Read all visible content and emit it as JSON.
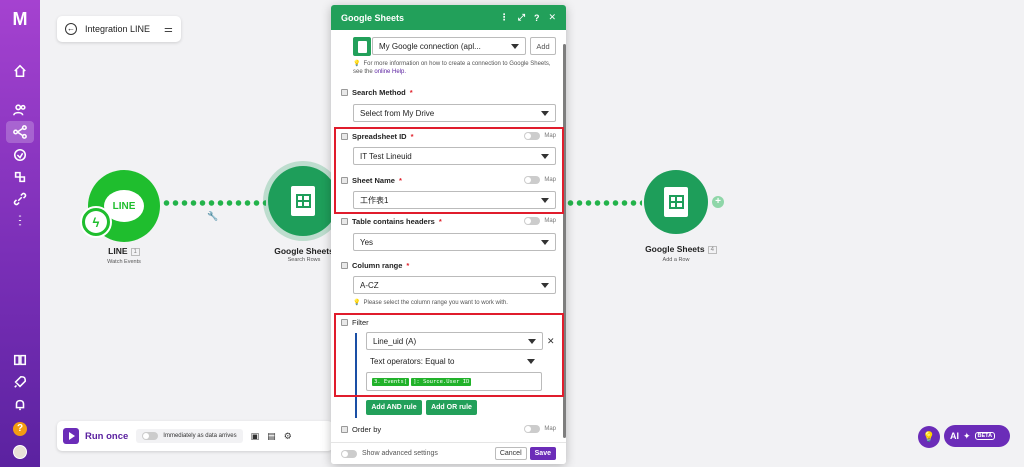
{
  "scenario": {
    "title": "Integration LINE"
  },
  "modules": [
    {
      "name": "LINE",
      "number": "1",
      "sub": "Watch Events",
      "icon_text": "LINE"
    },
    {
      "name": "Google Sheets",
      "number": "",
      "sub": "Search Rows"
    },
    {
      "name": "Google Sheets",
      "number": "4",
      "sub": "Add a Row"
    }
  ],
  "panel": {
    "title": "Google Sheets",
    "connection": {
      "value": "My Google connection (apl...",
      "add_label": "Add",
      "hint_prefix": "For more information on how to create a connection to Google Sheets, see the ",
      "hint_link": "online Help."
    },
    "search_method": {
      "label": "Search Method",
      "value": "Select from My Drive"
    },
    "spreadsheet_id": {
      "label": "Spreadsheet ID",
      "value": "IT Test Lineuid",
      "map": "Map"
    },
    "sheet_name": {
      "label": "Sheet Name",
      "value": "工作表1",
      "map": "Map"
    },
    "table_headers": {
      "label": "Table contains headers",
      "value": "Yes",
      "map": "Map"
    },
    "column_range": {
      "label": "Column range",
      "value": "A-CZ",
      "hint": "Please select the column range you want to work with."
    },
    "filter": {
      "label": "Filter",
      "column": "Line_uid (A)",
      "operator": "Text operators: Equal to",
      "value_pills": [
        "3. Events[",
        "]: Source.User ID"
      ],
      "add_and": "Add AND rule",
      "add_or": "Add OR rule"
    },
    "order_by": {
      "label": "Order by",
      "map": "Map"
    },
    "footer": {
      "advanced": "Show advanced settings",
      "cancel": "Cancel",
      "save": "Save"
    }
  },
  "toolbar": {
    "run_once": "Run once",
    "immediately": "Immediately as data arrives"
  },
  "ai": {
    "label": "AI",
    "beta": "BETA"
  },
  "colors": {
    "brand_purple": "#6b2cb8",
    "sheets_green": "#22a05a",
    "line_green": "#1fbe2e",
    "highlight_red": "#e01c2c"
  }
}
